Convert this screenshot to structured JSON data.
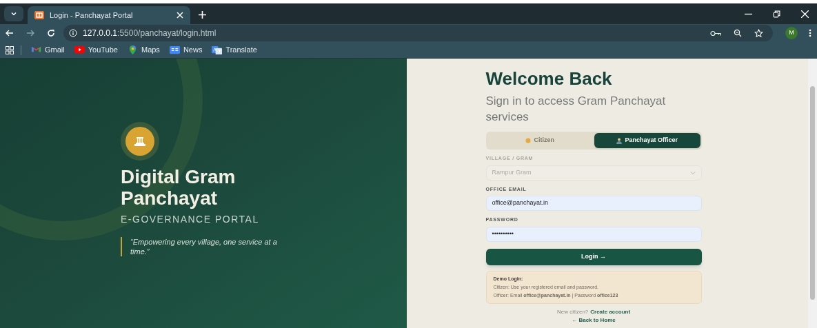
{
  "browser": {
    "tab_title": "Login - Panchayat Portal",
    "url_host": "127.0.0.1",
    "url_path": ":5500/panchayat/login.html",
    "avatar": "M",
    "bookmarks": [
      {
        "label": "Gmail",
        "kind": "gmail"
      },
      {
        "label": "YouTube",
        "kind": "youtube"
      },
      {
        "label": "Maps",
        "kind": "maps"
      },
      {
        "label": "News",
        "kind": "news"
      },
      {
        "label": "Translate",
        "kind": "translate"
      }
    ]
  },
  "hero": {
    "title": "Digital Gram Panchayat",
    "subtitle": "E-GOVERNANCE PORTAL",
    "quote": "“Empowering every village, one service at a time.”"
  },
  "login": {
    "heading": "Welcome Back",
    "subheading": "Sign in to access Gram Panchayat services",
    "roles": [
      {
        "label": "Citizen",
        "kind": "citizen",
        "selected": false
      },
      {
        "label": "Panchayat Officer",
        "kind": "officer",
        "selected": true
      }
    ],
    "fields": [
      {
        "label": "VILLAGE / GRAM",
        "kind": "select",
        "value": "Rampur Gram",
        "disabled": true
      },
      {
        "label": "OFFICE EMAIL",
        "kind": "text",
        "value": "office@panchayat.in",
        "disabled": false
      },
      {
        "label": "PASSWORD",
        "kind": "password",
        "value": "••••••••••",
        "disabled": false
      }
    ],
    "submit": "Login →",
    "demo": {
      "title": "Demo Login:",
      "lines": [
        "Citizen: Use your registered email and password.",
        "Officer: Email **office@panchayat.in** | Password **office123**"
      ]
    },
    "signup_prompt": "New citizen?",
    "signup_link": "Create account",
    "back_link": "← Back to Home"
  }
}
